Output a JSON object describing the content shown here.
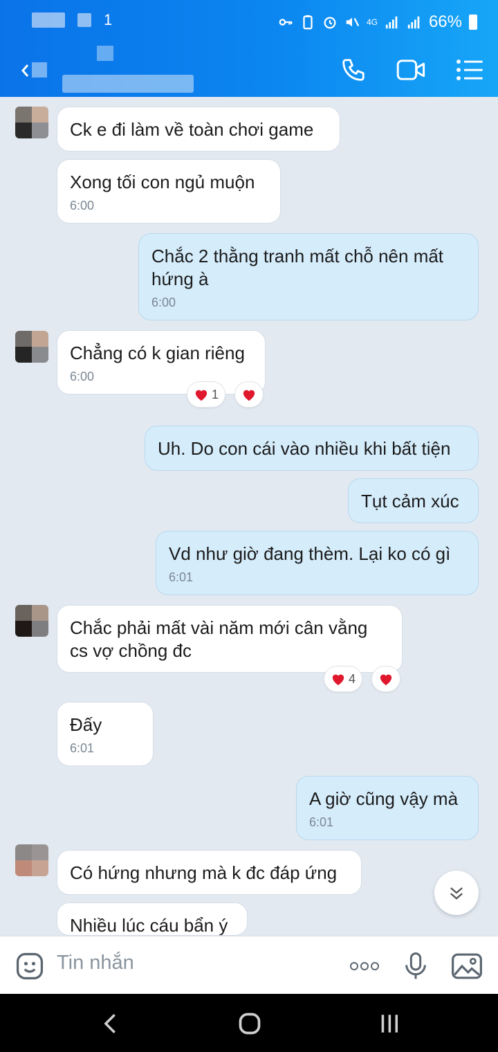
{
  "status_bar": {
    "battery": "66%",
    "network": "4G"
  },
  "header": {
    "icons": [
      "back-icon",
      "phone-icon",
      "video-call-icon",
      "menu-icon"
    ]
  },
  "messages": [
    {
      "side": "them",
      "text": "Ck e đi làm về toàn chơi game"
    },
    {
      "side": "them",
      "text": "Xong tối con ngủ muộn",
      "time": "6:00"
    },
    {
      "side": "me",
      "text": "Chắc 2 thằng tranh mất chỗ nên mất hứng à",
      "time": "6:00"
    },
    {
      "side": "them",
      "text": "Chẳng có k gian riêng",
      "time": "6:00",
      "reaction_count": "1"
    },
    {
      "side": "me",
      "text": "Uh. Do con cái vào nhiều khi bất tiện"
    },
    {
      "side": "me",
      "text": "Tụt cảm xúc"
    },
    {
      "side": "me",
      "text": "Vd như giờ đang thèm. Lại ko có gì",
      "time": "6:01"
    },
    {
      "side": "them",
      "text": "Chắc phải mất vài năm mới cân vằng cs vợ chồng đc",
      "reaction_count": "4"
    },
    {
      "side": "them",
      "text": "Đấy",
      "time": "6:01"
    },
    {
      "side": "me",
      "text": "A giờ cũng vậy mà",
      "time": "6:01"
    },
    {
      "side": "them",
      "text": "Có hứng nhưng mà k đc đáp ứng"
    },
    {
      "side": "them",
      "text": "Nhiều lúc cáu bẩn ý"
    }
  ],
  "composer": {
    "placeholder": "Tin nhắn"
  },
  "colors": {
    "header": "#0b86f0",
    "my_bubble": "#d5ecfb",
    "their_bubble": "#ffffff",
    "heart": "#e0182d"
  }
}
